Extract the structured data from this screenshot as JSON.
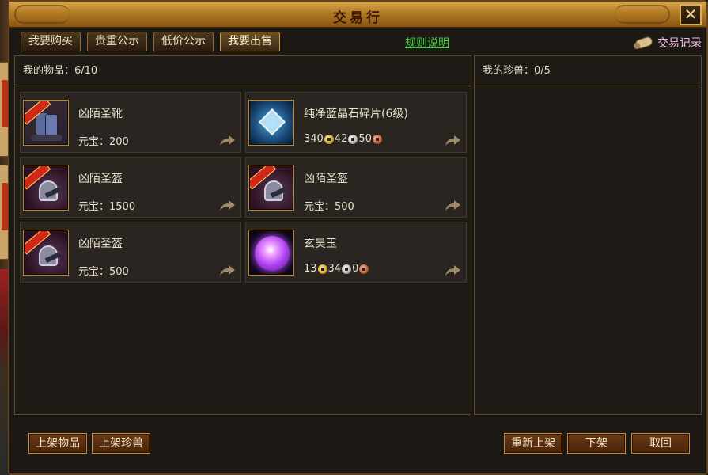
{
  "window": {
    "title": "交易行",
    "close_label": "✕"
  },
  "tabs": [
    {
      "label": "我要购买"
    },
    {
      "label": "贵重公示"
    },
    {
      "label": "低价公示"
    },
    {
      "label": "我要出售"
    }
  ],
  "rules_link": "规则说明",
  "trade_record": "交易记录",
  "left_panel": {
    "header": "我的物品：6/10",
    "items": [
      {
        "name": "凶陌圣靴",
        "price_label": "元宝：200",
        "icon": "boots-icon"
      },
      {
        "name": "纯净蓝晶石碎片(6级)",
        "price": {
          "gold": "340",
          "silver": "42",
          "copper": "50"
        },
        "icon": "crystal-icon"
      },
      {
        "name": "凶陌圣盔",
        "price_label": "元宝：1500",
        "icon": "helmet-icon"
      },
      {
        "name": "凶陌圣盔",
        "price_label": "元宝：500",
        "icon": "helmet-icon"
      },
      {
        "name": "凶陌圣盔",
        "price_label": "元宝：500",
        "icon": "helmet-icon"
      },
      {
        "name": "玄昊玉",
        "price": {
          "gold": "13",
          "silver": "34",
          "copper": "0"
        },
        "icon": "jade-orb-icon"
      }
    ]
  },
  "right_panel": {
    "header": "我的珍兽：0/5"
  },
  "buttons": {
    "list_item": "上架物品",
    "list_beast": "上架珍兽",
    "relist": "重新上架",
    "delist": "下架",
    "cancel": "取回"
  },
  "colors": {
    "title_gold": "#c8903a",
    "link_green": "#3ed23e",
    "panel_border": "#5e4a2a",
    "item_frame": "#b8862c"
  }
}
